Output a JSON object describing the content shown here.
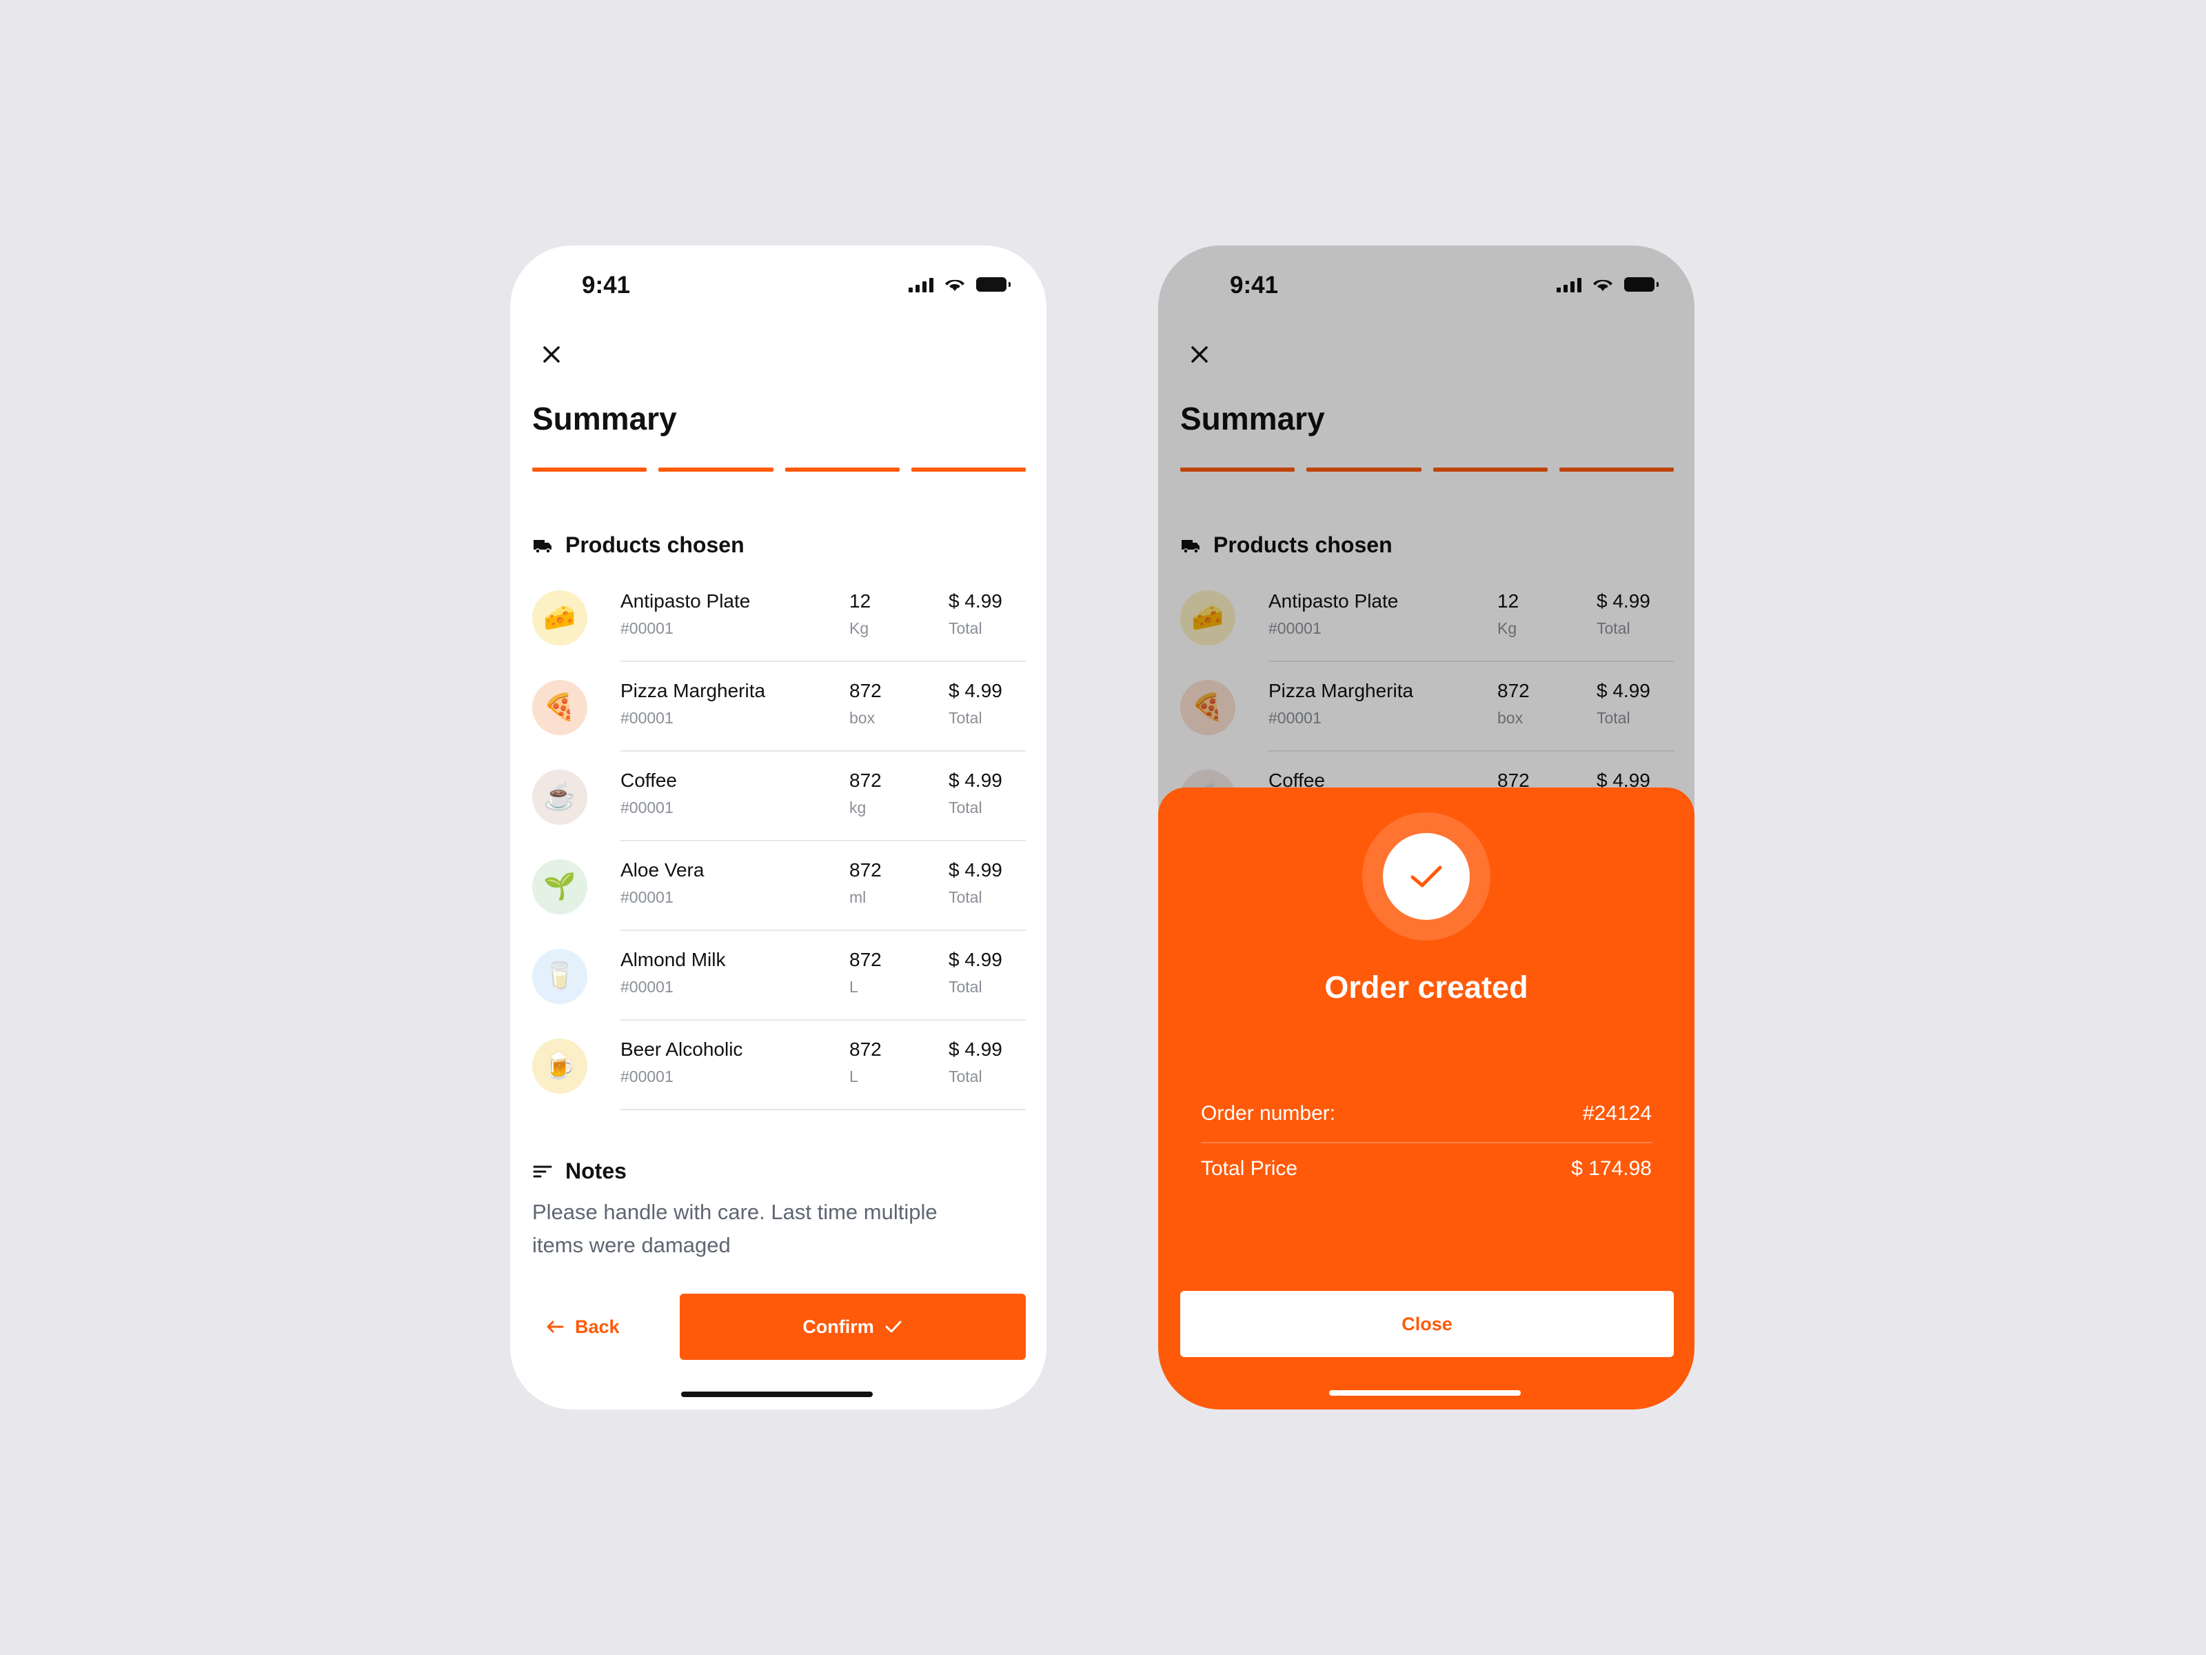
{
  "status": {
    "time": "9:41"
  },
  "summary": {
    "title": "Summary",
    "section_products": "Products chosen",
    "products": [
      {
        "name": "Antipasto Plate",
        "code": "#00001",
        "qty": "12",
        "unit": "Kg",
        "price": "$ 4.99",
        "price_label": "Total",
        "icon": "🧀",
        "icon_bg": "#fbf1c4"
      },
      {
        "name": "Pizza Margherita",
        "code": "#00001",
        "qty": "872",
        "unit": "box",
        "price": "$ 4.99",
        "price_label": "Total",
        "icon": "🍕",
        "icon_bg": "#fbe0d0"
      },
      {
        "name": "Coffee",
        "code": "#00001",
        "qty": "872",
        "unit": "kg",
        "price": "$ 4.99",
        "price_label": "Total",
        "icon": "☕",
        "icon_bg": "#f1e7e3"
      },
      {
        "name": "Aloe Vera",
        "code": "#00001",
        "qty": "872",
        "unit": "ml",
        "price": "$ 4.99",
        "price_label": "Total",
        "icon": "🌱",
        "icon_bg": "#e3f2e5"
      },
      {
        "name": "Almond Milk",
        "code": "#00001",
        "qty": "872",
        "unit": "L",
        "price": "$ 4.99",
        "price_label": "Total",
        "icon": "🥛",
        "icon_bg": "#e4f0fb"
      },
      {
        "name": "Beer Alcoholic",
        "code": "#00001",
        "qty": "872",
        "unit": "L",
        "price": "$ 4.99",
        "price_label": "Total",
        "icon": "🍺",
        "icon_bg": "#fbefc8"
      }
    ],
    "section_notes": "Notes",
    "notes_text": "Please handle with care. Last time multiple items were damaged",
    "back_label": "Back",
    "confirm_label": "Confirm"
  },
  "order_sheet": {
    "title": "Order created",
    "order_number_label": "Order number:",
    "order_number_value": "#24124",
    "total_label": "Total Price",
    "total_value": "$ 174.98",
    "close_label": "Close"
  },
  "colors": {
    "accent": "#ff5a0a",
    "background": "#e8e8ec"
  }
}
